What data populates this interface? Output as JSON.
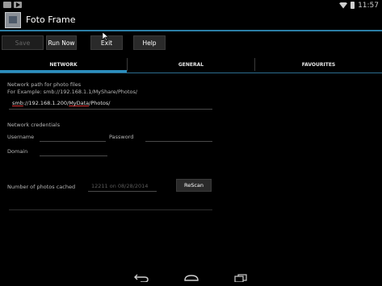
{
  "status_bar": {
    "time": "11:57"
  },
  "action_bar": {
    "title": "Foto Frame"
  },
  "buttons": {
    "save": "Save",
    "run_now": "Run Now",
    "exit": "Exit",
    "help": "Help"
  },
  "tabs": [
    {
      "label": "NETWORK",
      "selected": true
    },
    {
      "label": "GENERAL",
      "selected": false
    },
    {
      "label": "FAVOURITES",
      "selected": false
    }
  ],
  "network": {
    "path_label": "Network path for photo files",
    "example": "For Example:  smb://192.168.1.1/MyShare/Photos/",
    "path_value_part1": "smb",
    "path_value_part2": "://192.168.1.200/",
    "path_value_part3": "MyData",
    "path_value_part4": "/Photos/",
    "credentials_label": "Network credentials",
    "username_label": "Username",
    "username_value": "",
    "password_label": "Password",
    "password_value": "",
    "domain_label": "Domain",
    "domain_value": "",
    "cached_label": "Number of photos cached",
    "cached_value": "12211 on 08/28/2014",
    "rescan_label": "ReScan"
  },
  "colors": {
    "accent": "#2c8fbf",
    "background": "#000000"
  },
  "icons": [
    "image-icon",
    "play-store-icon",
    "wifi-icon",
    "battery-icon",
    "back-icon",
    "home-icon",
    "recents-icon"
  ]
}
